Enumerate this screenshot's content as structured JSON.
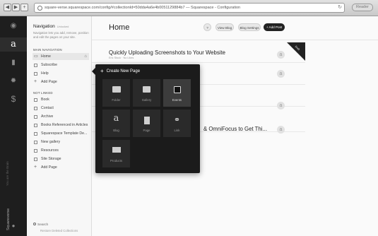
{
  "browser": {
    "url": "square-verse.squarespace.com/config/#collectionId=50dda4a6e4b0051129884b7 — Squarespace - Configuration",
    "reader_label": "Reader"
  },
  "rail": {
    "tagline": "You are the Brain",
    "brand": "Squareverse",
    "icons": [
      "eye-icon",
      "logo-icon",
      "chart-icon",
      "gear-icon",
      "dollar-icon",
      "help-icon"
    ]
  },
  "navigation": {
    "title": "Navigation",
    "unlocked": "Unlocked",
    "description": "Navigation lets you add, remove, position and edit the pages on your site.",
    "main_section": "MAIN NAVIGATION",
    "main_items": [
      "Home",
      "Subscribe",
      "Help",
      "Add Page"
    ],
    "not_linked_section": "NOT LINKED",
    "not_linked_items": [
      "Book",
      "Contact",
      "Archive",
      "Books Referenced in Articles",
      "Squarespace Template De...",
      "New gallery",
      "Resources",
      "Site Storage",
      "Add Page"
    ],
    "search_label": "Search",
    "restore_label": "Restore Deleted Collections"
  },
  "main": {
    "title": "Home",
    "help_label": "?",
    "view_blog_label": "View Blog",
    "blog_settings_label": "Blog Settings",
    "add_post_label": "+ Add Post",
    "corner_label": "Draft",
    "posts": [
      {
        "title": "Quickly Uploading Screenshots to Your Website",
        "meta": "Eric Stock · No Likes"
      },
      {
        "title": "",
        "meta": ""
      },
      {
        "title": "",
        "meta": ""
      },
      {
        "title": "& OmniFocus to Get Thi...",
        "meta": ""
      }
    ]
  },
  "popup": {
    "title": "Create New Page",
    "tiles": [
      "Folder",
      "Gallery",
      "Events",
      "Blog",
      "Page",
      "Link",
      "Products"
    ]
  }
}
